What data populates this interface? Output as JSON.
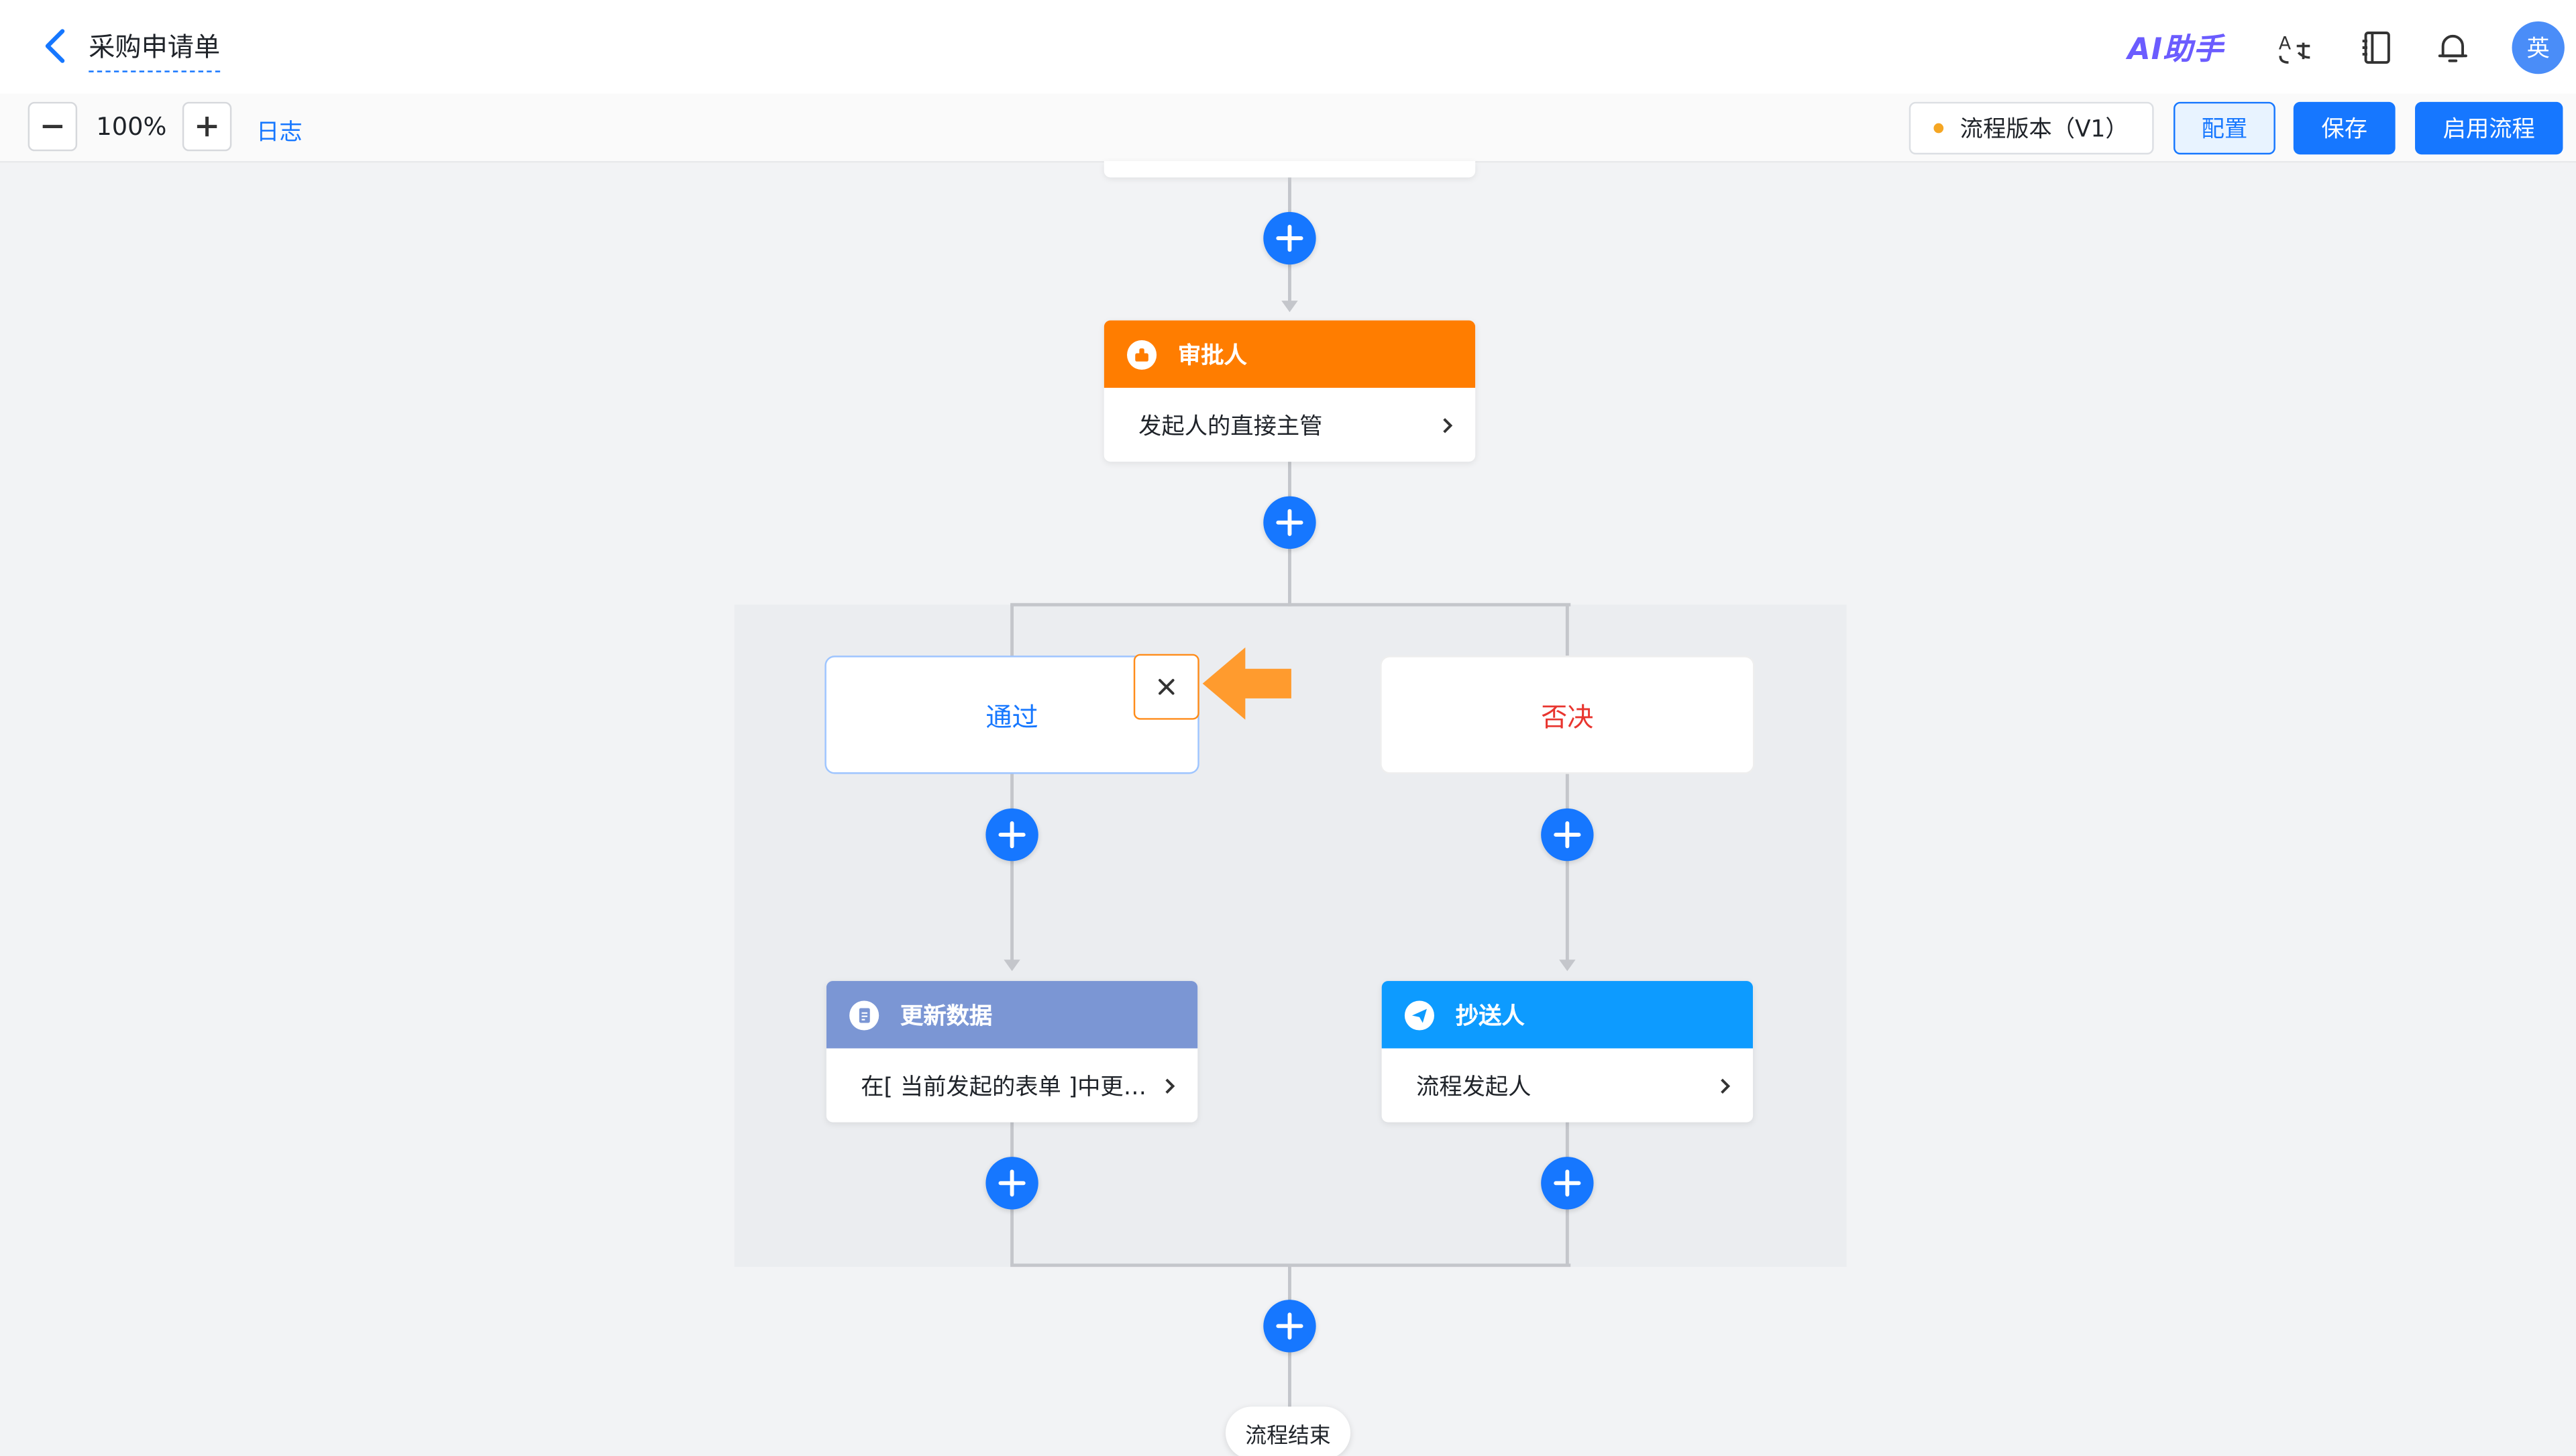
{
  "header": {
    "title": "采购申请单",
    "ai_helper": "AI助手",
    "avatar_text": "英"
  },
  "toolbar": {
    "zoom_level": "100%",
    "log_label": "日志",
    "version_label": "流程版本（V1）",
    "config_label": "配置",
    "save_label": "保存",
    "enable_label": "启用流程"
  },
  "flow": {
    "approver_node": {
      "title": "审批人",
      "detail": "发起人的直接主管"
    },
    "branches": {
      "pass": {
        "label": "通过"
      },
      "reject": {
        "label": "否决"
      }
    },
    "update_node": {
      "title": "更新数据",
      "detail": "在[ 当前发起的表单 ]中更新数据"
    },
    "cc_node": {
      "title": "抄送人",
      "detail": "流程发起人"
    },
    "end_label": "流程结束"
  },
  "icons": [
    "back-icon",
    "ai-helper-icon",
    "translate-icon",
    "notebook-icon",
    "bell-icon",
    "minus-icon",
    "plus-icon",
    "close-icon",
    "chevron-right-icon",
    "stamp-icon",
    "document-icon",
    "send-icon"
  ],
  "colors": {
    "primary": "#1677ff",
    "approver_orange": "#ff7d00",
    "update_purple": "#7b96d4",
    "cc_blue": "#0d9bff",
    "reject_red": "#e8352f",
    "highlight_orange": "#ff8c1a"
  }
}
